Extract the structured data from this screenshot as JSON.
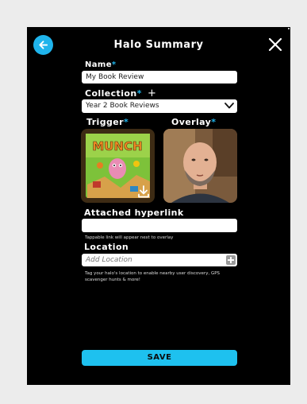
{
  "header": {
    "title": "Halo Summary",
    "back_icon": "arrow-left-icon",
    "close_icon": "close-icon"
  },
  "form": {
    "name": {
      "label": "Name",
      "value": "My Book Review"
    },
    "collection": {
      "label": "Collection",
      "add_symbol": "+",
      "selected": "Year 2 Book Reviews"
    },
    "trigger": {
      "label": "Trigger",
      "image_text": "MUNCH"
    },
    "overlay": {
      "label": "Overlay"
    },
    "hyperlink": {
      "label": "Attached hyperlink",
      "value": "",
      "helper": "Tappable link will appear next to overlay"
    },
    "location": {
      "label": "Location",
      "placeholder": "Add Location",
      "helper": "Tag your halo's location to enable nearby user discovery, GPS scavenger hunts & more!"
    },
    "required_marker": "*"
  },
  "actions": {
    "save_label": "SAVE"
  },
  "colors": {
    "accent": "#1fb4ec",
    "save_button": "#1ec1ef",
    "background": "#000000",
    "frame": "#ececec"
  }
}
